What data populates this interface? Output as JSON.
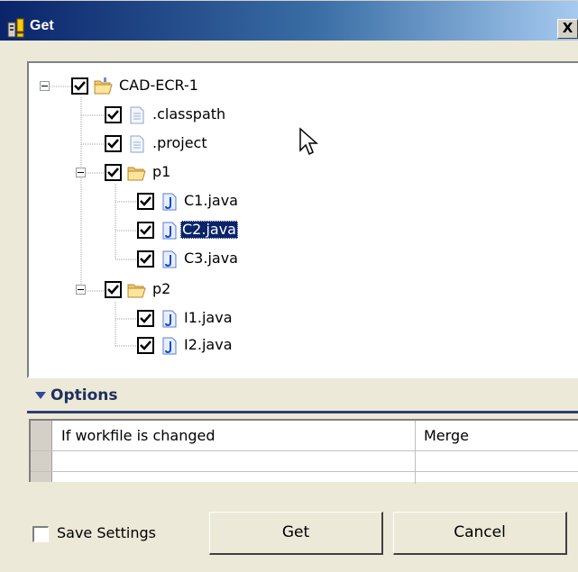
{
  "window": {
    "title": "Get",
    "close_label": "X"
  },
  "tree": {
    "nodes": [
      {
        "label": "CAD-ECR-1",
        "type": "project-folder",
        "checked": true,
        "expanded": true
      },
      {
        "label": ".classpath",
        "type": "file",
        "checked": true
      },
      {
        "label": ".project",
        "type": "file",
        "checked": true
      },
      {
        "label": "p1",
        "type": "folder",
        "checked": true,
        "expanded": true
      },
      {
        "label": "C1.java",
        "type": "java-file",
        "checked": true
      },
      {
        "label": "C2.java",
        "type": "java-file",
        "checked": true,
        "selected": true
      },
      {
        "label": "C3.java",
        "type": "java-file",
        "checked": true
      },
      {
        "label": "p2",
        "type": "folder",
        "checked": true,
        "expanded": true
      },
      {
        "label": "I1.java",
        "type": "java-file",
        "checked": true
      },
      {
        "label": "I2.java",
        "type": "java-file",
        "checked": true
      }
    ]
  },
  "options": {
    "title": "Options",
    "rows": [
      {
        "name": "If workfile is changed",
        "value": "Merge"
      },
      {
        "name": "",
        "value": ""
      }
    ]
  },
  "footer": {
    "save_settings_label": "Save Settings",
    "save_settings_checked": false,
    "get_label": "Get",
    "cancel_label": "Cancel"
  },
  "colors": {
    "titlebar_start": "#0a246a",
    "selection": "#0a246a",
    "dialog_bg": "#ece9d8",
    "options_title": "#1f2f5f"
  }
}
